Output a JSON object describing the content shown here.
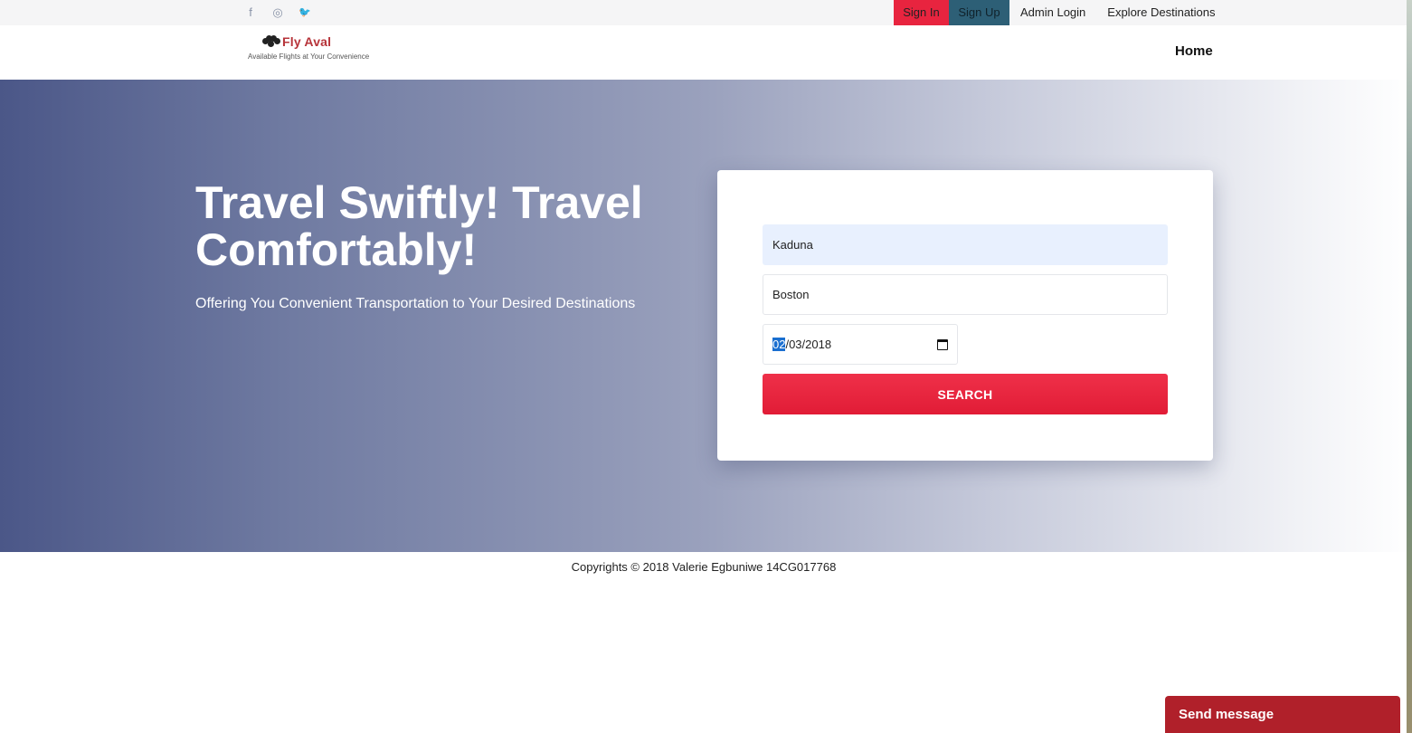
{
  "topbar": {
    "social": [
      {
        "icon": "facebook-icon",
        "glyph": "f"
      },
      {
        "icon": "instagram-icon",
        "glyph": "◎"
      },
      {
        "icon": "twitter-icon",
        "glyph": "🐦"
      }
    ],
    "sign_in": "Sign In",
    "sign_up": "Sign Up",
    "admin_login": "Admin Login",
    "explore": "Explore Destinations"
  },
  "navbar": {
    "logo_name": "Fly Aval",
    "logo_tagline": "Available Flights at Your Convenience",
    "home": "Home"
  },
  "hero": {
    "title": "Travel Swiftly! Travel Comfortably!",
    "subtitle": "Offering You Convenient Transportation to Your Desired Destinations"
  },
  "search_form": {
    "from_value": "Kaduna",
    "to_value": "Boston",
    "date_selected_part": "02",
    "date_rest": "/03/2018",
    "search_label": "SEARCH"
  },
  "footer": {
    "copyright": "Copyrights © 2018 Valerie Egbuniwe 14CG017768"
  },
  "chat": {
    "send_message": "Send message"
  },
  "colors": {
    "accent_red": "#e8243f",
    "signup_teal": "#2d5f76",
    "hero_start": "#4b5788",
    "chat_red": "#b0202a"
  }
}
